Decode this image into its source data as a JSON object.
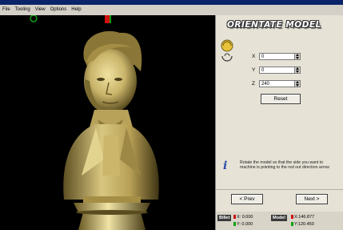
{
  "menu": [
    "File",
    "Tooling",
    "View",
    "Options",
    "Help"
  ],
  "panel": {
    "title": "ORIENTATE MODEL",
    "fields": [
      {
        "label": "X",
        "value": "0"
      },
      {
        "label": "Y",
        "value": "0"
      },
      {
        "label": "Z",
        "value": "240"
      }
    ],
    "reset_label": "Reset",
    "help_text": "Rotate the model so that the side you want to machine is pointing to the red out direction arrow",
    "prev_label": "< Prev",
    "next_label": "Next >"
  },
  "status": {
    "billet_label": "Billet",
    "billet_x": "X: 0.000",
    "billet_y": "Y: 0.000",
    "model_label": "Model",
    "model_x": "X:146.877",
    "model_y": "Y:120.450"
  },
  "colors": {
    "axis_x": "#d01010",
    "axis_y": "#10a010",
    "model": "#c9b46a"
  }
}
